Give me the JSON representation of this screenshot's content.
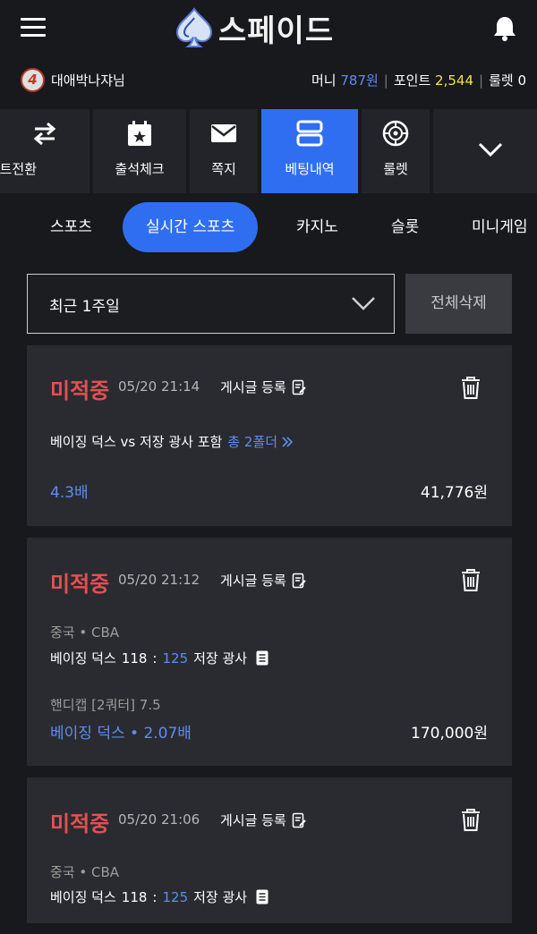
{
  "header": {
    "logo_text": "스페이드"
  },
  "user": {
    "level": "4",
    "name": "대애박나쟈님",
    "money_label": "머니",
    "money_value": "787원",
    "point_label": "포인트",
    "point_value": "2,544",
    "roulette_label": "룰렛",
    "roulette_value": "0"
  },
  "menu": [
    {
      "label": "포인트전환",
      "icon": "swap-arrows-icon"
    },
    {
      "label": "출석체크",
      "icon": "calendar-star-icon"
    },
    {
      "label": "쪽지",
      "icon": "envelope-icon"
    },
    {
      "label": "베팅내역",
      "icon": "list-rows-icon",
      "active": true
    },
    {
      "label": "룰렛",
      "icon": "roulette-icon"
    },
    {
      "label": "",
      "icon": "chevron-down-icon"
    }
  ],
  "tabs": [
    "스포츠",
    "실시간 스포츠",
    "카지노",
    "슬롯",
    "미니게임"
  ],
  "filter": {
    "selected": "최근 1주일",
    "delete_all": "전체삭제"
  },
  "cards": [
    {
      "status": "미적중",
      "time": "05/20 21:14",
      "post_label": "게시글 등록",
      "summary_text": "베이징 덕스 vs 저장 광사 포함",
      "folder_text": "총 2폴더",
      "odds": "4.3배",
      "amount": "41,776원"
    },
    {
      "status": "미적중",
      "time": "05/20 21:12",
      "post_label": "게시글 등록",
      "league": "중국 • CBA",
      "home_team": "베이징 덕스",
      "home_score": "118",
      "away_score": "125",
      "away_team": "저장 광사",
      "market": "핸디캡 [2쿼터] 7.5",
      "pick": "베이징 덕스 • 2.07배",
      "amount": "170,000원"
    },
    {
      "status": "미적중",
      "time": "05/20 21:06",
      "post_label": "게시글 등록",
      "league": "중국 • CBA",
      "home_team": "베이징 덕스",
      "home_score": "118",
      "away_score": "125",
      "away_team": "저장 광사"
    }
  ],
  "colors": {
    "accent": "#2f6ef0",
    "miss_red": "#e45050",
    "point_yellow": "#f3e14a",
    "money_blue": "#5e8cf0"
  }
}
